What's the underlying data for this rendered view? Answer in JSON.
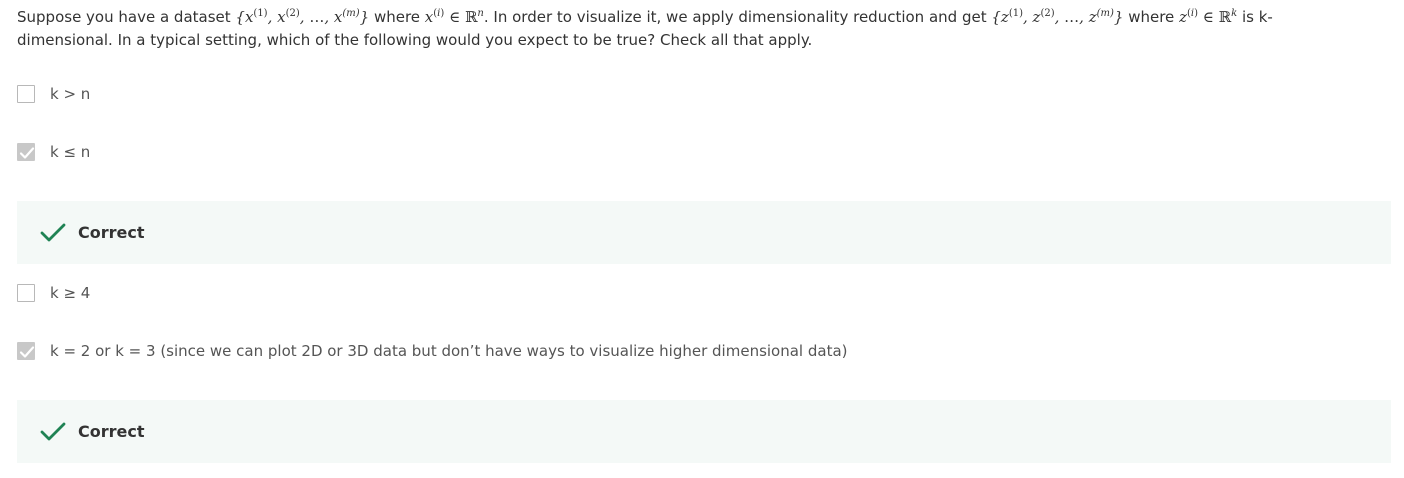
{
  "question": {
    "part1": "Suppose you have a dataset ",
    "set_x": "{x(1), x(2), …, x(m)}",
    "part2": " where ",
    "x_in": "x(i) ∈ ℝn",
    "part3": ". In order to visualize it, we apply dimensionality reduction and get ",
    "set_z": "{z(1), z(2), …, z(m)}",
    "part4": " where ",
    "z_in": "z(i) ∈ ℝk",
    "part5": " is k-dimensional. In a typical setting, which of the following would you expect to be true? Check all that apply."
  },
  "options": [
    {
      "label": "k > n",
      "checked": false
    },
    {
      "label": "k ≤ n",
      "checked": true
    },
    {
      "label": "k ≥ 4",
      "checked": false
    },
    {
      "label": "k = 2 or k = 3 (since we can plot 2D or 3D data but don’t have ways to visualize higher dimensional data)",
      "checked": true
    }
  ],
  "feedback": [
    {
      "label": "Correct",
      "icon": "checkmark-icon"
    },
    {
      "label": "Correct",
      "icon": "checkmark-icon"
    }
  ],
  "colors": {
    "feedback_bg": "#f4f9f7",
    "check_green": "#1f8354",
    "checked_box": "#c8c8c8"
  }
}
